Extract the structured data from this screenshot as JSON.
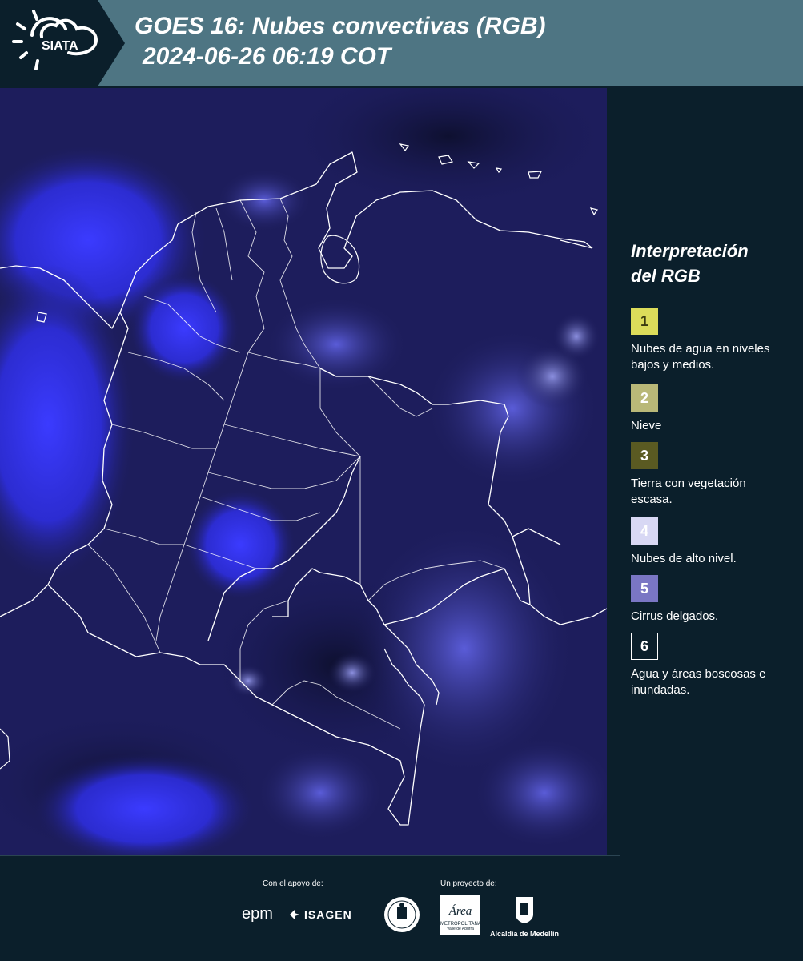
{
  "header": {
    "logo_text": "SIATA",
    "title_line1": "GOES 16: Nubes convectivas (RGB)",
    "title_line2": "2024-06-26 06:19 COT"
  },
  "legend": {
    "title_line1": "Interpretación",
    "title_line2": "del RGB",
    "items": [
      {
        "number": "1",
        "label": "Nubes de agua en niveles bajos y medios.",
        "color": "#dcdc5a",
        "text_color": "#3a3a10"
      },
      {
        "number": "2",
        "label": "Nieve",
        "color": "#b9b878",
        "text_color": "#ffffff"
      },
      {
        "number": "3",
        "label": "Tierra con vegetación escasa.",
        "color": "#5a5a22",
        "text_color": "#ffffff"
      },
      {
        "number": "4",
        "label": "Nubes de alto nivel.",
        "color": "#d8d8f4",
        "text_color": "#ffffff"
      },
      {
        "number": "5",
        "label": "Cirrus delgados.",
        "color": "#7a76c4",
        "text_color": "#ffffff"
      },
      {
        "number": "6",
        "label": "Agua y áreas boscosas e inundadas.",
        "color": "#0b1f2b",
        "text_color": "#ffffff"
      }
    ]
  },
  "footer": {
    "support_label": "Con el apoyo de:",
    "project_label": "Un proyecto de:",
    "sponsor1": "epm",
    "sponsor2": "ISAGEN",
    "partner_area": "Área",
    "partner_area_sub1": "METROPOLITANA",
    "partner_area_sub2": "Valle de Aburrá",
    "partner_alcaldia": "Alcaldía de Medellín"
  },
  "colors": {
    "header_bg": "#4e7583",
    "page_bg": "#0b1f2b",
    "map_base": "#1c1c5a",
    "cloud_blue": "#3a3aff"
  }
}
